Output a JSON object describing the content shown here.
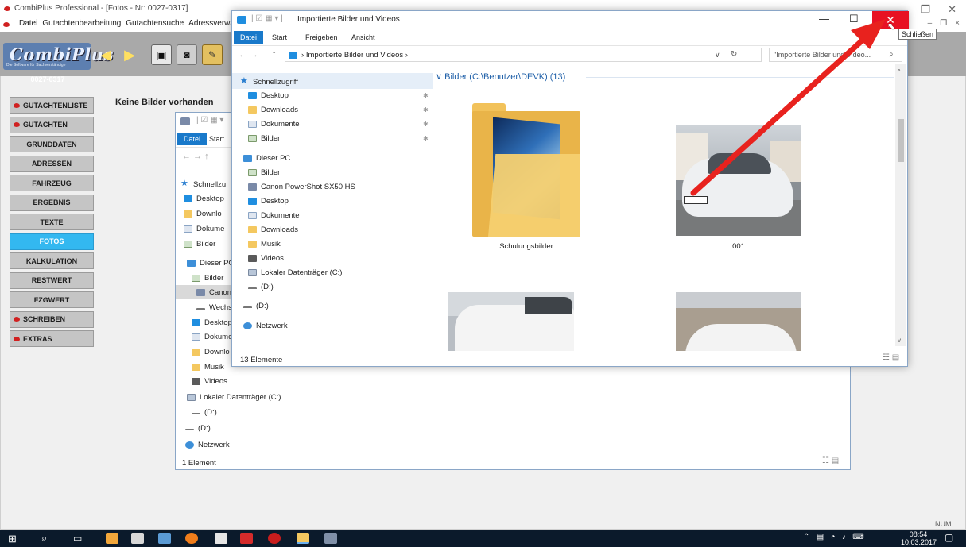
{
  "app": {
    "title": "CombiPlus Professional - [Fotos - Nr: 0027-0317]",
    "menu": [
      "Datei",
      "Gutachtenbearbeitung",
      "Gutachtensuche",
      "Adressverwaltur"
    ],
    "logo_text": "CombiPlus",
    "logo_sub": "Die Software für Sachverständige",
    "record_no": "0027-0317",
    "empty_message": "Keine Bilder vorhanden",
    "nav_items": [
      {
        "label": "GUTACHTENLISTE",
        "bullet": true,
        "active": false
      },
      {
        "label": "GUTACHTEN",
        "bullet": true,
        "active": false
      },
      {
        "label": "GRUNDDATEN",
        "bullet": false,
        "active": false
      },
      {
        "label": "ADRESSEN",
        "bullet": false,
        "active": false
      },
      {
        "label": "FAHRZEUG",
        "bullet": false,
        "active": false
      },
      {
        "label": "ERGEBNIS",
        "bullet": false,
        "active": false
      },
      {
        "label": "TEXTE",
        "bullet": false,
        "active": false
      },
      {
        "label": "FOTOS",
        "bullet": false,
        "active": true
      },
      {
        "label": "KALKULATION",
        "bullet": false,
        "active": false
      },
      {
        "label": "RESTWERT",
        "bullet": false,
        "active": false
      },
      {
        "label": "FZGWERT",
        "bullet": false,
        "active": false
      },
      {
        "label": "SCHREIBEN",
        "bullet": true,
        "active": false
      },
      {
        "label": "EXTRAS",
        "bullet": true,
        "active": false
      }
    ],
    "status_indicator": "NUM"
  },
  "explorer_front": {
    "title": "Importierte Bilder und Videos",
    "ribbon_tabs": [
      "Datei",
      "Start",
      "Freigeben",
      "Ansicht"
    ],
    "breadcrumb": "Importierte Bilder und Videos",
    "search_placeholder": "\"Importierte Bilder und Video...",
    "tree": [
      {
        "label": "Schnellzugriff",
        "icon": "star",
        "pinned": false,
        "selected": true
      },
      {
        "label": "Desktop",
        "icon": "folder-blue",
        "pinned": true
      },
      {
        "label": "Downloads",
        "icon": "download",
        "pinned": true
      },
      {
        "label": "Dokumente",
        "icon": "doc",
        "pinned": true
      },
      {
        "label": "Bilder",
        "icon": "img",
        "pinned": true
      },
      {
        "label": "Dieser PC",
        "icon": "pc",
        "pinned": false
      },
      {
        "label": "Bilder",
        "icon": "img",
        "pinned": false
      },
      {
        "label": "Canon PowerShot SX50 HS",
        "icon": "cam",
        "pinned": false
      },
      {
        "label": "Desktop",
        "icon": "folder-blue",
        "pinned": false
      },
      {
        "label": "Dokumente",
        "icon": "doc",
        "pinned": false
      },
      {
        "label": "Downloads",
        "icon": "download",
        "pinned": false
      },
      {
        "label": "Musik",
        "icon": "music",
        "pinned": false
      },
      {
        "label": "Videos",
        "icon": "video",
        "pinned": false
      },
      {
        "label": "Lokaler Datenträger (C:)",
        "icon": "drive",
        "pinned": false
      },
      {
        "label": "(D:)",
        "icon": "usb",
        "pinned": false
      },
      {
        "label": "(D:)",
        "icon": "usb",
        "pinned": false
      },
      {
        "label": "Netzwerk",
        "icon": "net",
        "pinned": false
      }
    ],
    "group_header": "Bilder (C:\\Benutzer\\DEVK) (13)",
    "items": [
      {
        "label": "Schulungsbilder",
        "kind": "folder"
      },
      {
        "label": "001",
        "kind": "photo"
      },
      {
        "label": "",
        "kind": "photo"
      },
      {
        "label": "",
        "kind": "photo"
      }
    ],
    "status": "13 Elemente",
    "tooltip": "Schließen"
  },
  "explorer_back": {
    "ribbon_tabs": [
      "Datei",
      "Start"
    ],
    "tree": [
      {
        "label": "Schnellzu",
        "icon": "star"
      },
      {
        "label": "Desktop",
        "icon": "folder-blue"
      },
      {
        "label": "Downlo",
        "icon": "download"
      },
      {
        "label": "Dokume",
        "icon": "doc"
      },
      {
        "label": "Bilder",
        "icon": "img"
      },
      {
        "label": "Dieser PC",
        "icon": "pc"
      },
      {
        "label": "Bilder",
        "icon": "img"
      },
      {
        "label": "Canon F",
        "icon": "cam"
      },
      {
        "label": "Wechs",
        "icon": "usb"
      },
      {
        "label": "Desktop",
        "icon": "folder-blue"
      },
      {
        "label": "Dokume",
        "icon": "doc"
      },
      {
        "label": "Downlo",
        "icon": "download"
      },
      {
        "label": "Musik",
        "icon": "music"
      },
      {
        "label": "Videos",
        "icon": "video"
      },
      {
        "label": "Lokaler Datenträger (C:)",
        "icon": "drive"
      },
      {
        "label": "(D:)",
        "icon": "usb"
      },
      {
        "label": "(D:)",
        "icon": "usb"
      },
      {
        "label": "Netzwerk",
        "icon": "net"
      }
    ],
    "status": "1 Element"
  },
  "taskbar": {
    "time": "08:54",
    "date": "10.03.2017"
  },
  "colors": {
    "accent": "#1979ca",
    "nav_active": "#33b8f0",
    "close_red": "#e81123",
    "arrow_red": "#e8221e"
  }
}
